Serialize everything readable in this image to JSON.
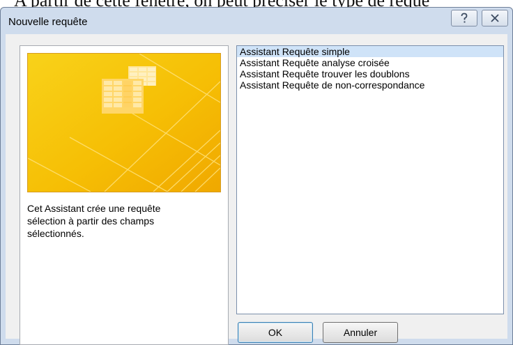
{
  "background_text": "A partir de cette fenêtre, on peut préciser le type de requê",
  "dialog": {
    "title": "Nouvelle requête",
    "help_icon": "question-mark-icon",
    "close_icon": "close-x-icon"
  },
  "preview": {
    "description": "Cet Assistant crée une requête sélection à partir des champs sélectionnés."
  },
  "query_types": [
    {
      "label": "Assistant Requête simple",
      "selected": true
    },
    {
      "label": "Assistant Requête analyse croisée",
      "selected": false
    },
    {
      "label": "Assistant Requête trouver les doublons",
      "selected": false
    },
    {
      "label": "Assistant Requête de non-correspondance",
      "selected": false
    }
  ],
  "buttons": {
    "ok": "OK",
    "cancel": "Annuler"
  },
  "colors": {
    "preview_gold": "#f6c200",
    "selection": "#cfe3f8",
    "frame": "#cfdced"
  }
}
